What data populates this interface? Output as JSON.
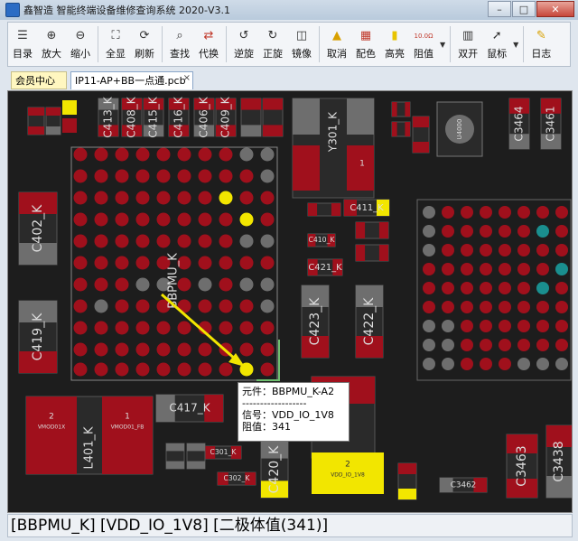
{
  "window": {
    "title": "鑫智造 智能终端设备维修查询系统 2020-V3.1"
  },
  "toolbar": {
    "buttons": [
      {
        "id": "catalog",
        "label": "目录",
        "icon": "catalog-icon"
      },
      {
        "id": "zoom-in",
        "label": "放大",
        "icon": "zoom-in-icon"
      },
      {
        "id": "zoom-out",
        "label": "缩小",
        "icon": "zoom-out-icon"
      },
      {
        "id": "fit",
        "label": "全显",
        "icon": "fit-screen-icon"
      },
      {
        "id": "refresh",
        "label": "刷新",
        "icon": "refresh-icon"
      },
      {
        "id": "find",
        "label": "查找",
        "icon": "search-icon"
      },
      {
        "id": "replace",
        "label": "代换",
        "icon": "replace-icon"
      },
      {
        "id": "rotate-ccw",
        "label": "逆旋",
        "icon": "rotate-ccw-icon"
      },
      {
        "id": "rotate-cw",
        "label": "正旋",
        "icon": "rotate-cw-icon"
      },
      {
        "id": "mirror",
        "label": "镜像",
        "icon": "mirror-icon"
      },
      {
        "id": "cancel",
        "label": "取消",
        "icon": "cancel-icon"
      },
      {
        "id": "color",
        "label": "配色",
        "icon": "palette-icon"
      },
      {
        "id": "highlight",
        "label": "高亮",
        "icon": "highlight-icon"
      },
      {
        "id": "resistance",
        "label": "阻值",
        "icon": "resistance-icon",
        "icon_text": "10.0Ω"
      },
      {
        "id": "dual",
        "label": "双开",
        "icon": "dual-open-icon"
      },
      {
        "id": "mouse",
        "label": "鼠标",
        "icon": "mouse-icon"
      },
      {
        "id": "log",
        "label": "日志",
        "icon": "log-icon"
      }
    ]
  },
  "tabs": [
    {
      "label": "会员中心",
      "active": false
    },
    {
      "label": "IP11-AP+BB一点通.pcb",
      "active": true,
      "close": "×"
    }
  ],
  "board": {
    "labels": {
      "bbpmu": "BBPMU_K",
      "c402": "C402_K",
      "c419": "C419_K",
      "c413": "C413_K",
      "c408": "C408_K",
      "c415": "C415_K",
      "c416": "C416_K",
      "c406": "C406_K",
      "c409": "C409_K",
      "y301": "Y301_K",
      "u400": "U4000",
      "c3464": "C3464",
      "c3461": "C3461",
      "c411": "C411_K",
      "c410": "C410_K",
      "c421": "C421_K",
      "c423": "C423_K",
      "c422": "C422_K",
      "c417": "C417_K",
      "l401": "L401_K",
      "vmod1": "VMOD01X",
      "vmod1b": "VMOD01_FB",
      "pad2a": "2",
      "pad1a": "1",
      "pad2b": "2",
      "pad1b": "1",
      "pad2c": "2",
      "pad1c": "1",
      "c301": "C301_K",
      "c302": "C302_K",
      "c420": "C420_K",
      "c3462": "C3462",
      "c3463": "C3463",
      "c3438": "C3438",
      "vdd": "VDD_IO_1V8"
    }
  },
  "tooltip": {
    "component": "元件：BBPMU_K-A2",
    "divider": "------------------",
    "signal": "信号：VDD_IO_1V8",
    "value": "阻值：341"
  },
  "status": {
    "text": "[BBPMU_K] [VDD_IO_1V8] [二极体值(341)]"
  },
  "colors": {
    "pad_red": "#a0101c",
    "pad_gray": "#6e6e6e",
    "pad_yellow": "#f2e600",
    "pad_teal": "#1a8f8f",
    "board": "#1d1d1d"
  }
}
